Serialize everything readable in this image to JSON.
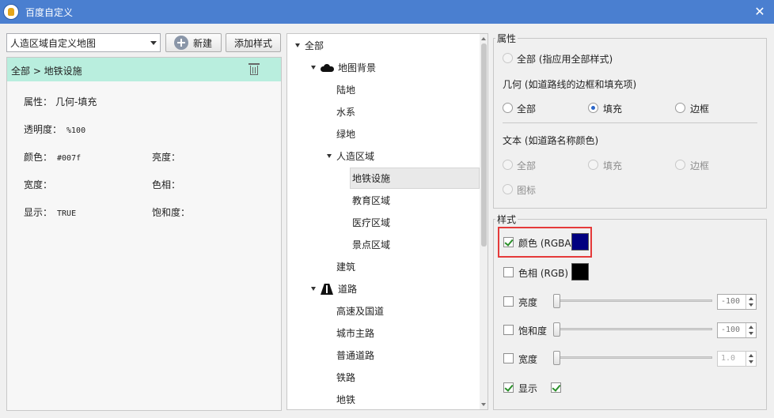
{
  "window": {
    "title": "百度自定义",
    "close_glyph": "✕"
  },
  "toolbar": {
    "map_select_value": "人造区域自定义地图",
    "new_button": "新建",
    "add_style_button": "添加样式"
  },
  "detail": {
    "breadcrumb": "全部 > 地铁设施",
    "props": [
      {
        "key": "属性：",
        "value": "几何-填充"
      },
      {
        "key": "透明度：",
        "value": "%100"
      },
      {
        "key": "颜色：",
        "value": "#007f"
      },
      {
        "key": "亮度：",
        "value": ""
      },
      {
        "key": "宽度：",
        "value": ""
      },
      {
        "key": "色相：",
        "value": ""
      },
      {
        "key": "显示：",
        "value": "TRUE"
      },
      {
        "key": "饱和度：",
        "value": ""
      }
    ]
  },
  "tree": [
    {
      "label": "全部",
      "level": 0,
      "expanded": true
    },
    {
      "label": "地图背景",
      "level": 1,
      "expanded": true,
      "icon": "cloud-icon"
    },
    {
      "label": "陆地",
      "level": 2
    },
    {
      "label": "水系",
      "level": 2
    },
    {
      "label": "绿地",
      "level": 2
    },
    {
      "label": "人造区域",
      "level": 2,
      "expanded": true
    },
    {
      "label": "地铁设施",
      "level": 3,
      "selected": true
    },
    {
      "label": "教育区域",
      "level": 3
    },
    {
      "label": "医疗区域",
      "level": 3
    },
    {
      "label": "景点区域",
      "level": 3
    },
    {
      "label": "建筑",
      "level": 2
    },
    {
      "label": "道路",
      "level": 1,
      "expanded": true,
      "icon": "road-icon"
    },
    {
      "label": "高速及国道",
      "level": 2
    },
    {
      "label": "城市主路",
      "level": 2
    },
    {
      "label": "普通道路",
      "level": 2
    },
    {
      "label": "铁路",
      "level": 2
    },
    {
      "label": "地铁",
      "level": 2
    }
  ],
  "attributes": {
    "title": "属性",
    "all_option": "全部 (指应用全部样式)",
    "geometry_heading": "几何 (如道路线的边框和填充项)",
    "geometry_options": [
      "全部",
      "填充",
      "边框"
    ],
    "geometry_selected": "填充",
    "text_heading": "文本 (如道路名称颜色)",
    "text_options": [
      "全部",
      "填充",
      "边框",
      "图标"
    ]
  },
  "style": {
    "title": "样式",
    "color_label": "颜色 (RGBA)",
    "color_checked": true,
    "color_value": "#000080",
    "hue_label": "色相 (RGB)",
    "hue_checked": false,
    "hue_value": "#000000",
    "brightness_label": "亮度",
    "brightness_value": "-100",
    "saturation_label": "饱和度",
    "saturation_value": "-100",
    "width_label": "宽度",
    "width_value": "1.0",
    "show_label": "显示",
    "show_checked": true,
    "show_value_checked": true
  }
}
